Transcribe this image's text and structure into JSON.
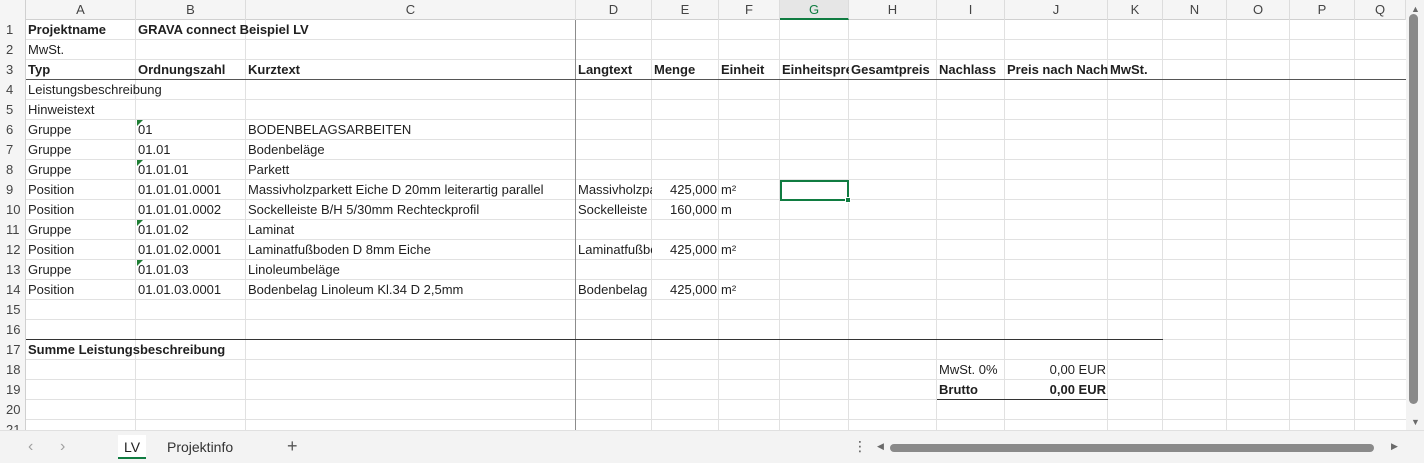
{
  "columns": [
    "A",
    "B",
    "C",
    "D",
    "E",
    "F",
    "G",
    "H",
    "I",
    "J",
    "K",
    "N",
    "O",
    "P",
    "Q"
  ],
  "rows": [
    "1",
    "2",
    "3",
    "4",
    "5",
    "6",
    "7",
    "8",
    "9",
    "10",
    "11",
    "12",
    "13",
    "14",
    "15",
    "16",
    "17",
    "18",
    "19",
    "20",
    "21"
  ],
  "cells": {
    "r1": {
      "a": "Projektname",
      "b": "GRAVA connect Beispiel LV"
    },
    "r2": {
      "a": "MwSt."
    },
    "r3": {
      "a": "Typ",
      "b": "Ordnungszahl",
      "c": "Kurztext",
      "d": "Langtext",
      "e": "Menge",
      "f": "Einheit",
      "g": "Einheitspreis",
      "h": "Gesamtpreis",
      "i": "Nachlass",
      "j": "Preis nach Nachlass",
      "k": "MwSt."
    },
    "r4": {
      "a": "Leistungsbeschreibung"
    },
    "r5": {
      "a": "Hinweistext"
    },
    "r6": {
      "a": "Gruppe",
      "b": "01",
      "c": "BODENBELAGSARBEITEN"
    },
    "r7": {
      "a": "Gruppe",
      "b": "01.01",
      "c": "Bodenbeläge"
    },
    "r8": {
      "a": "Gruppe",
      "b": "01.01.01",
      "c": "Parkett"
    },
    "r9": {
      "a": "Position",
      "b": "01.01.01.0001",
      "c": "Massivholzparkett Eiche D 20mm leiterartig parallel",
      "d": "Massivholzparkett",
      "e": "425,000",
      "f": "m²"
    },
    "r10": {
      "a": "Position",
      "b": "01.01.01.0002",
      "c": "Sockelleiste B/H 5/30mm Rechteckprofil",
      "d": "Sockelleiste",
      "e": "160,000",
      "f": "m"
    },
    "r11": {
      "a": "Gruppe",
      "b": "01.01.02",
      "c": "Laminat"
    },
    "r12": {
      "a": "Position",
      "b": "01.01.02.0001",
      "c": "Laminatfußboden D 8mm Eiche",
      "d": "Laminatfußboden",
      "e": "425,000",
      "f": "m²"
    },
    "r13": {
      "a": "Gruppe",
      "b": "01.01.03",
      "c": "Linoleumbeläge"
    },
    "r14": {
      "a": "Position",
      "b": "01.01.03.0001",
      "c": "Bodenbelag Linoleum Kl.34 D 2,5mm",
      "d": "Bodenbelag",
      "e": "425,000",
      "f": "m²"
    },
    "r17": {
      "a": "Summe Leistungsbeschreibung"
    },
    "r18": {
      "i": "MwSt. 0%",
      "j": "0,00 EUR"
    },
    "r19": {
      "i": "Brutto",
      "j": "0,00 EUR"
    }
  },
  "tabs": [
    {
      "label": "LV",
      "active": true
    },
    {
      "label": "Projektinfo",
      "active": false
    }
  ],
  "add_sheet_label": "+",
  "menu_label": "⋮",
  "nav_prev": "‹",
  "nav_next": "›",
  "accent_color": "#107c41"
}
